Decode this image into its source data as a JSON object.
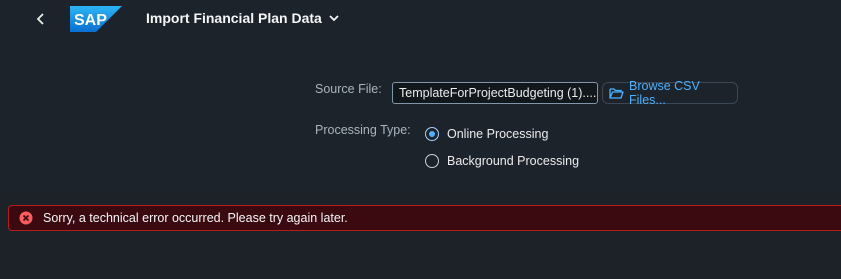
{
  "header": {
    "title": "Import Financial Plan Data",
    "logo_text": "SAP"
  },
  "form": {
    "source_file_label": "Source File:",
    "source_file_value": "TemplateForProjectBudgeting (1)....",
    "browse_label": "Browse CSV Files...",
    "processing_type_label": "Processing Type:",
    "options": [
      {
        "label": "Online Processing",
        "selected": true
      },
      {
        "label": "Background Processing",
        "selected": false
      }
    ]
  },
  "error": {
    "message": "Sorry, a technical error occurred. Please try again later."
  },
  "colors": {
    "background": "#1d232a",
    "accent": "#4db1ff",
    "error_bg": "#3a0a10",
    "error_border": "#b71c1c",
    "error_icon": "#ff5c5c"
  },
  "icons": {
    "back": "chevron-left-icon",
    "title_menu": "chevron-down-icon",
    "browse": "folder-open-icon",
    "error": "error-circle-icon"
  }
}
